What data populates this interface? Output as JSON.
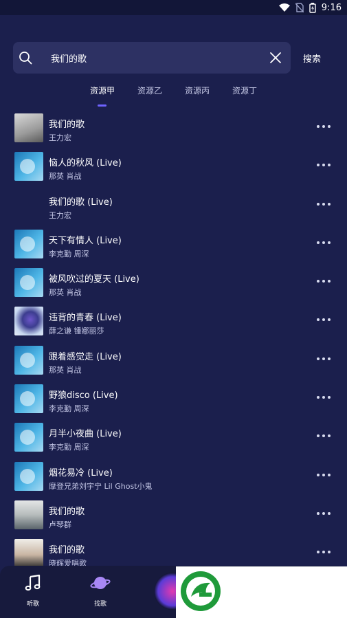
{
  "status_bar": {
    "time": "9:16",
    "icons": [
      "wifi-icon",
      "no-sim-icon",
      "battery-icon"
    ]
  },
  "search": {
    "query": "我们的歌",
    "button_label": "搜索"
  },
  "tabs": [
    {
      "label": "资源甲",
      "active": true
    },
    {
      "label": "资源乙",
      "active": false
    },
    {
      "label": "资源丙",
      "active": false
    },
    {
      "label": "资源丁",
      "active": false
    }
  ],
  "songs": [
    {
      "title": "我们的歌",
      "artist": "王力宏"
    },
    {
      "title": "恼人的秋风 (Live)",
      "artist": "那英  肖战"
    },
    {
      "title": "我们的歌 (Live)",
      "artist": "王力宏"
    },
    {
      "title": "天下有情人 (Live)",
      "artist": "李克勤  周深"
    },
    {
      "title": "被风吹过的夏天 (Live)",
      "artist": "那英  肖战"
    },
    {
      "title": "违背的青春 (Live)",
      "artist": "薛之谦  锺娜丽莎"
    },
    {
      "title": "跟着感觉走 (Live)",
      "artist": "那英  肖战"
    },
    {
      "title": "野狼disco (Live)",
      "artist": "李克勤  周深"
    },
    {
      "title": "月半小夜曲 (Live)",
      "artist": "李克勤  周深"
    },
    {
      "title": "烟花易冷 (Live)",
      "artist": "摩登兄弟刘宇宁  Lil Ghost小鬼"
    },
    {
      "title": "我们的歌",
      "artist": "卢琴群"
    },
    {
      "title": "我们的歌",
      "artist": "晓辉爱唱歌"
    }
  ],
  "bottom_nav": [
    {
      "label": "听歌",
      "icon": "music-note-icon"
    },
    {
      "label": "找歌",
      "icon": "planet-icon"
    }
  ],
  "colors": {
    "background": "#1b1f4d",
    "search_field": "#2d3163",
    "tab_indicator": "#6f63ff",
    "logo_green": "#1f9a3a"
  }
}
